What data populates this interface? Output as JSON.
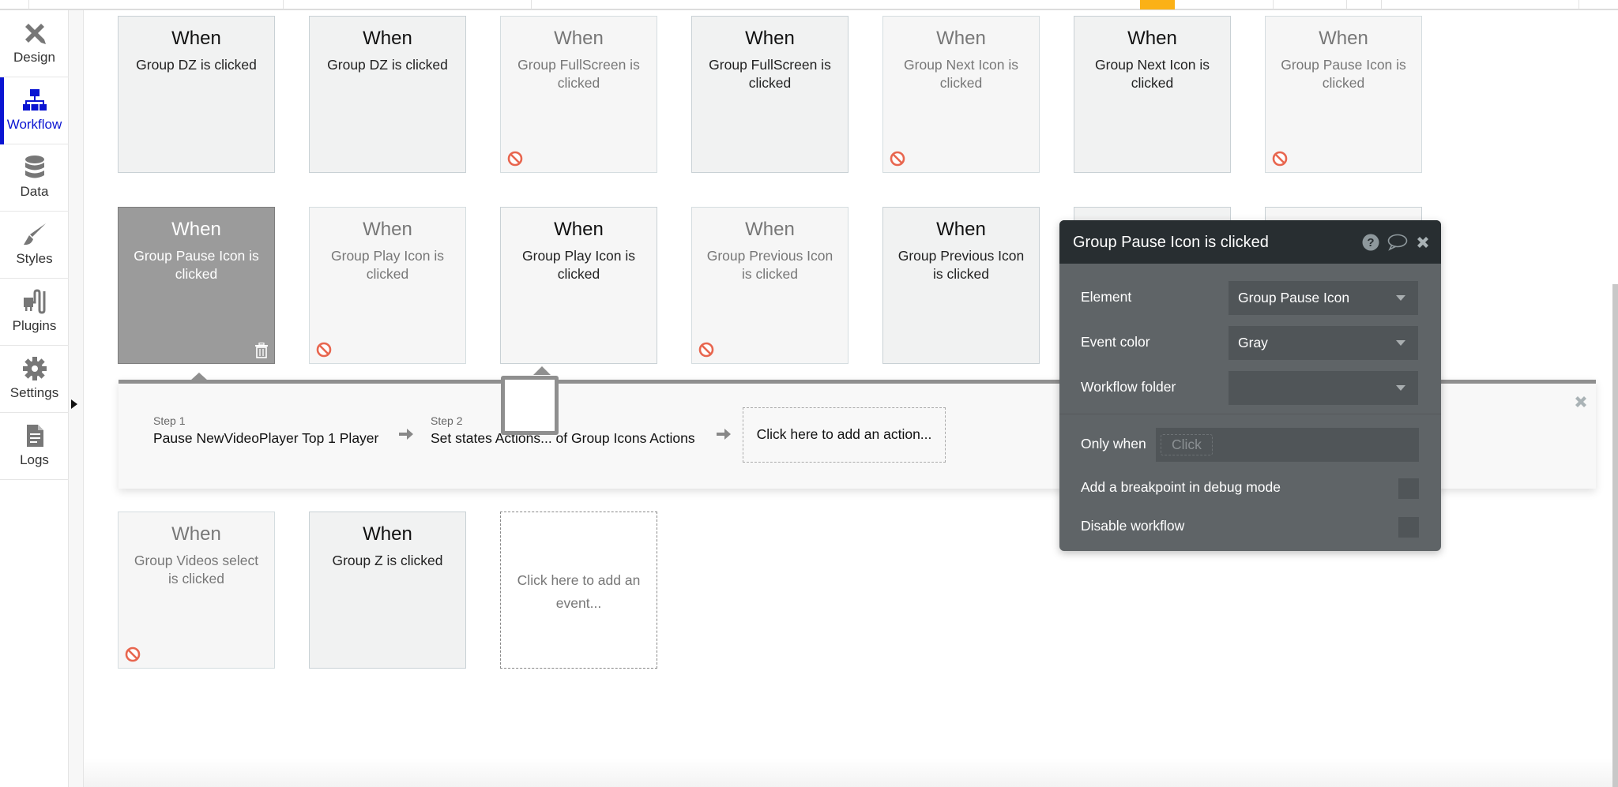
{
  "sidebar": {
    "items": [
      {
        "label": "Design",
        "icon": "design-icon",
        "active": false
      },
      {
        "label": "Workflow",
        "icon": "workflow-icon",
        "active": true
      },
      {
        "label": "Data",
        "icon": "database-icon",
        "active": false
      },
      {
        "label": "Styles",
        "icon": "brush-icon",
        "active": false
      },
      {
        "label": "Plugins",
        "icon": "plug-icon",
        "active": false
      },
      {
        "label": "Settings",
        "icon": "gear-icon",
        "active": false
      },
      {
        "label": "Logs",
        "icon": "document-icon",
        "active": false
      }
    ]
  },
  "colors": {
    "accent": "#0a14d2",
    "topbar_highlight": "#fbb116",
    "disabled_icon": "#e8664f",
    "editor_header": "#282e31",
    "editor_body": "#5f6467"
  },
  "events": {
    "when_label": "When",
    "cards": [
      {
        "description": "Group DZ is clicked",
        "state": "normal"
      },
      {
        "description": "Group DZ is clicked",
        "state": "normal"
      },
      {
        "description": "Group FullScreen is clicked",
        "state": "disabled"
      },
      {
        "description": "Group FullScreen is clicked",
        "state": "normal"
      },
      {
        "description": "Group Next Icon is clicked",
        "state": "disabled"
      },
      {
        "description": "Group Next Icon is clicked",
        "state": "normal"
      },
      {
        "description": "Group Pause Icon is clicked",
        "state": "disabled"
      },
      {
        "description": "Group Pause Icon is clicked",
        "state": "selected"
      },
      {
        "description": "Group Play Icon is clicked",
        "state": "disabled"
      },
      {
        "description": "Group Play Icon is clicked",
        "state": "normal"
      },
      {
        "description": "Group Previous Icon is clicked",
        "state": "disabled"
      },
      {
        "description": "Group Previous Icon is clicked",
        "state": "normal"
      },
      {
        "description": "Group Videos select is clicked",
        "state": "disabled"
      },
      {
        "description": "Group Z is clicked",
        "state": "normal"
      }
    ],
    "add_event_label": "Click here to add an event..."
  },
  "steps": {
    "items": [
      {
        "number": "Step 1",
        "text": "Pause NewVideoPlayer Top 1 Player"
      },
      {
        "number": "Step 2",
        "text": "Set states Actions... of Group Icons Actions"
      }
    ],
    "add_action_label": "Click here to add an action..."
  },
  "editor": {
    "title": "Group Pause Icon is clicked",
    "element_label": "Element",
    "element_value": "Group Pause Icon",
    "event_color_label": "Event color",
    "event_color_value": "Gray",
    "workflow_folder_label": "Workflow folder",
    "workflow_folder_value": "",
    "only_when_label": "Only when",
    "only_when_placeholder": "Click",
    "breakpoint_label": "Add a breakpoint in debug mode",
    "breakpoint_checked": false,
    "disable_label": "Disable workflow",
    "disable_checked": false
  }
}
